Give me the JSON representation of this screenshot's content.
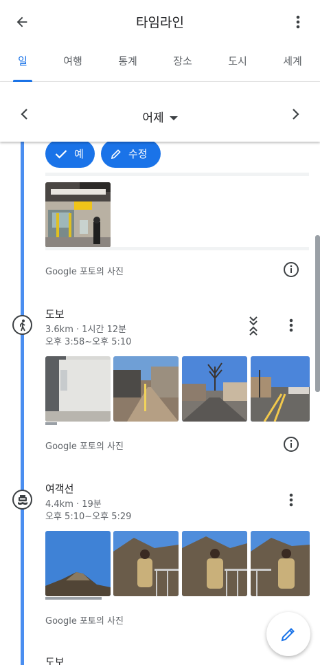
{
  "header": {
    "title": "타임라인"
  },
  "tabs": [
    {
      "label": "일",
      "active": true
    },
    {
      "label": "여행",
      "active": false
    },
    {
      "label": "통계",
      "active": false
    },
    {
      "label": "장소",
      "active": false
    },
    {
      "label": "도시",
      "active": false
    },
    {
      "label": "세계",
      "active": false
    }
  ],
  "date_nav": {
    "date": "어제"
  },
  "confirm": {
    "yes_label": "예",
    "edit_label": "수정"
  },
  "photos_caption": "Google 포토의 사진",
  "segments": [
    {
      "title": "도보",
      "distance_duration": "3.6km · 1시간 12분",
      "time_range": "오후 3:58~오후 5:10",
      "icon": "walking-icon"
    },
    {
      "title": "여객선",
      "distance_duration": "4.4km · 19분",
      "time_range": "오후 5:10~오후 5:29",
      "icon": "ferry-icon"
    },
    {
      "title": "도보"
    }
  ],
  "colors": {
    "accent": "#1a73e8",
    "timeline": "#4a8ef0"
  },
  "icons": [
    "back-arrow-icon",
    "more-vert-icon",
    "chevron-left-icon",
    "chevron-right-icon",
    "check-icon",
    "pencil-icon",
    "info-icon",
    "expand-icon",
    "edit-icon"
  ]
}
